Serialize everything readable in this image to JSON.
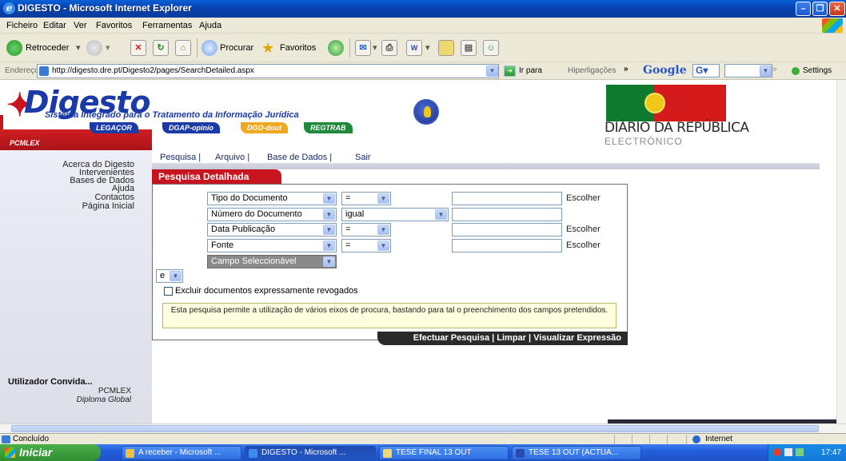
{
  "window": {
    "title": "DIGESTO - Microsoft Internet Explorer"
  },
  "menu": [
    "Ficheiro",
    "Editar",
    "Ver",
    "Favoritos",
    "Ferramentas",
    "Ajuda"
  ],
  "toolbar": {
    "back": "Retroceder",
    "search": "Procurar",
    "favorites": "Favoritos"
  },
  "address": {
    "label": "Endereço",
    "url": "http://digesto.dre.pt/Digesto2/pages/SearchDetailed.aspx",
    "go": "Ir para",
    "links": "Hiperligações",
    "google": "Google",
    "google_g": "G",
    "settings": "Settings"
  },
  "header": {
    "logo": "Digesto",
    "subtitle": "Sistema Integrado para o Tratamento da Informação Jurídica",
    "pills": [
      "LEGAÇOR",
      "DGAP-opinio",
      "DGO-dout",
      "REGTRAB"
    ],
    "dr_title": "DIÁRIO DA REPÚBLICA",
    "dr_sub": "ELECTRÓNICO",
    "corner_tag": "PCMLEX"
  },
  "sidebar": {
    "items": [
      "Acerca do Digesto",
      "Intervenientes",
      "Bases de Dados",
      "Ajuda",
      "Contactos",
      "Página Inicial"
    ],
    "user": {
      "title": "Utilizador Convida...",
      "org": "PCMLEX",
      "diploma": "Diploma Global"
    }
  },
  "topnav": [
    "Pesquisa |",
    "Arquivo |",
    "Base de Dados |",
    "Sair"
  ],
  "form": {
    "heading": "Pesquisa Detalhada",
    "rows": [
      {
        "field": "Tipo do Documento",
        "op": "=",
        "choose": "Escolher"
      },
      {
        "field": "Número do Documento",
        "op": "igual",
        "choose": ""
      },
      {
        "field": "Data Publicação",
        "op": "=",
        "choose": "Escolher"
      },
      {
        "field": "Fonte",
        "op": "=",
        "choose": "Escolher"
      }
    ],
    "extra_field": "Campo Seleccionável",
    "logic": "e",
    "exclude_label": "Excluir documentos expressamente revogados",
    "note": "Esta pesquisa permite a utilização de vários eixos de procura, bastando para tal o preenchimento dos campos pretendidos.",
    "actions": "Efectuar Pesquisa | Limpar | Visualizar Expressão"
  },
  "status": {
    "text": "Concluído",
    "zone": "Internet"
  },
  "taskbar": {
    "start": "Iniciar",
    "tasks": [
      "A receber - Microsoft ...",
      "DIGESTO - Microsoft ...",
      "TESE FINAL 13 OUT",
      "TESE 13 OUT (ACTUA..."
    ],
    "clock": "17:47"
  }
}
